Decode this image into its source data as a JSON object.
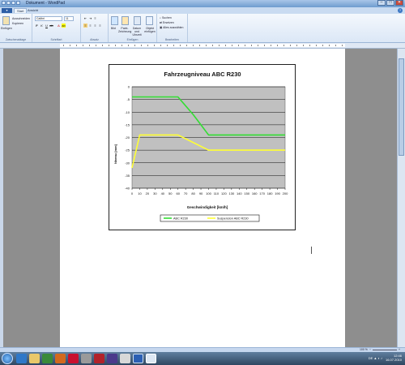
{
  "window": {
    "title": "Dokument - WordPad",
    "controls": [
      "–",
      "□",
      "✕"
    ]
  },
  "tabs": {
    "app_button": "▾",
    "items": [
      "Start",
      "Ansicht"
    ],
    "help": "?"
  },
  "ribbon": {
    "clipboard": {
      "paste": "Einfügen",
      "cut": "Ausschneiden",
      "copy": "Kopieren",
      "group": "Zwischenablage"
    },
    "font": {
      "family": "Calibri",
      "size": "11",
      "group": "Schriftart"
    },
    "paragraph": {
      "group": "Absatz"
    },
    "insert": {
      "image": "Bild",
      "paint": "Paint-Zeichnung",
      "datetime": "Datum und Uhrzeit",
      "object": "Objekt einfügen",
      "group": "Einfügen"
    },
    "editing": {
      "find": "Suchen",
      "replace": "Ersetzen",
      "select_all": "Alles auswählen",
      "group": "Bearbeiten"
    }
  },
  "chart_data": {
    "type": "line",
    "title": "Fahrzeugniveau ABC R230",
    "xlabel": "Geschwindigkeit [km/h]",
    "ylabel": "Niveau [mm]",
    "xlim": [
      0,
      200
    ],
    "ylim": [
      -40,
      0
    ],
    "x_ticks": [
      0,
      10,
      20,
      30,
      40,
      50,
      60,
      70,
      80,
      90,
      100,
      110,
      120,
      130,
      140,
      150,
      160,
      170,
      180,
      190,
      200
    ],
    "y_ticks": [
      0,
      -5,
      -10,
      -15,
      -20,
      -25,
      -30,
      -35,
      -40
    ],
    "grid": "horizontal",
    "plot_background": "#c0c0c0",
    "legend": "bottom",
    "series": [
      {
        "name": "ABC R230",
        "color": "#33dd33",
        "points": [
          [
            0,
            -4
          ],
          [
            60,
            -4
          ],
          [
            80,
            -11
          ],
          [
            100,
            -19
          ],
          [
            200,
            -19
          ]
        ]
      },
      {
        "name": "Suspension ABC R230",
        "color": "#ffff33",
        "points": [
          [
            0,
            -32
          ],
          [
            10,
            -19
          ],
          [
            60,
            -19
          ],
          [
            100,
            -25
          ],
          [
            200,
            -25
          ]
        ]
      }
    ]
  },
  "status": {
    "zoom": "100 %",
    "minus": "−",
    "plus": "+"
  },
  "taskbar": {
    "time": "12:46",
    "date": "16.07.2010",
    "lang": "DE"
  }
}
